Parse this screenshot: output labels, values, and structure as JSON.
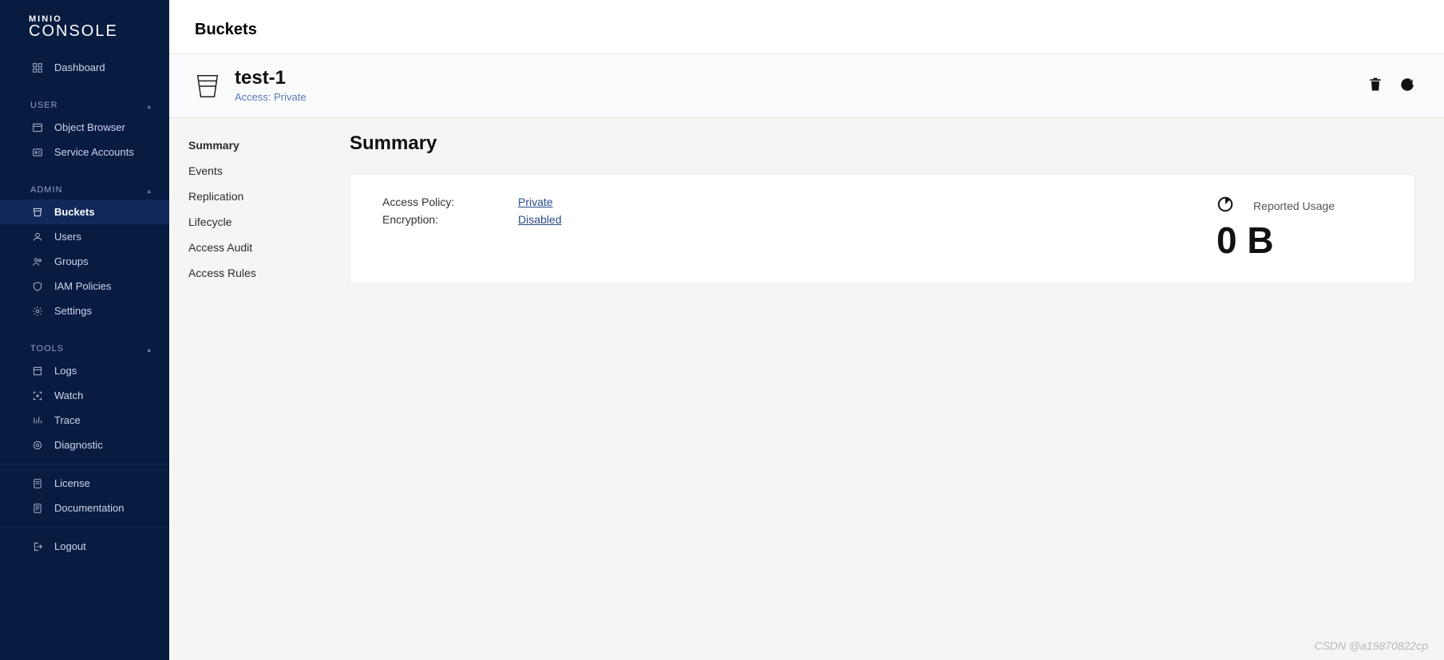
{
  "brand": {
    "top": "MINIO",
    "bottom": "CONSOLE"
  },
  "sidebar": {
    "dashboard": "Dashboard",
    "section_user": "USER",
    "object_browser": "Object Browser",
    "service_accounts": "Service Accounts",
    "section_admin": "ADMIN",
    "buckets": "Buckets",
    "users": "Users",
    "groups": "Groups",
    "iam_policies": "IAM Policies",
    "settings": "Settings",
    "section_tools": "TOOLS",
    "logs": "Logs",
    "watch": "Watch",
    "trace": "Trace",
    "diagnostic": "Diagnostic",
    "license": "License",
    "documentation": "Documentation",
    "logout": "Logout"
  },
  "page": {
    "title": "Buckets",
    "bucket_name": "test-1",
    "bucket_access_label": "Access: ",
    "bucket_access_value": "Private"
  },
  "subtabs": {
    "summary": "Summary",
    "events": "Events",
    "replication": "Replication",
    "lifecycle": "Lifecycle",
    "access_audit": "Access Audit",
    "access_rules": "Access Rules"
  },
  "summary": {
    "heading": "Summary",
    "access_policy_label": "Access Policy:",
    "access_policy_value": "Private",
    "encryption_label": "Encryption:",
    "encryption_value": "Disabled",
    "reported_usage_label": "Reported Usage",
    "reported_usage_value": "0 B"
  },
  "watermark": "CSDN @a19870822cp"
}
